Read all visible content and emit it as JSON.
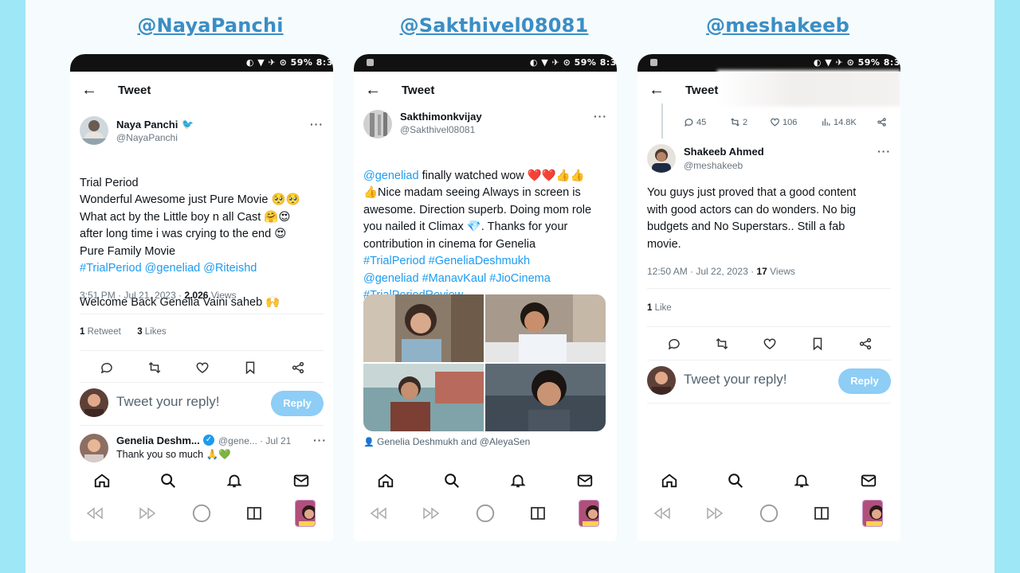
{
  "colors": {
    "page_bg": "#9ee7f7",
    "board_bg": "#f6fbfd",
    "handle": "#3a8ec5",
    "link": "#1d9bf0",
    "reply_btn": "#8dcdf6"
  },
  "status": {
    "icons": "◐ ▼ ✈ ⊙ 59% 8:3"
  },
  "common": {
    "tweet_title": "Tweet",
    "reply_placeholder": "Tweet your reply!",
    "reply_button": "Reply",
    "more": "···"
  },
  "panels": [
    {
      "handle_label": "@NayaPanchi",
      "author": {
        "name": "Naya Panchi",
        "handle": "@NayaPanchi",
        "verified": true
      },
      "text_plain": "Trial Period\nWonderful Awesome just Pure Movie 🥺🥺\nWhat act by the Little boy n all Cast 🤗😍\nafter long time i was crying to the end 😍\nPure Family Movie",
      "text_links": "#TrialPeriod @geneliad @Riteishd",
      "text_tail": "Welcome Back Genelia Vaini saheb 🙌",
      "meta_time": "3:51 PM · Jul 21, 2023 · ",
      "meta_views_count": "2,026",
      "meta_views_label": " Views",
      "retweets_count": "1",
      "retweets_label": " Retweet",
      "likes_count": "3",
      "likes_label": " Likes",
      "sub_reply": {
        "name": "Genelia Deshm...",
        "handle": "@gene...",
        "date": "· Jul 21",
        "text": "Thank you so much 🙏💚"
      }
    },
    {
      "handle_label": "@Sakthivel08081",
      "author": {
        "name": "Sakthimonkvijay",
        "handle": "@Sakthivel08081"
      },
      "text_mention": "@geneliad",
      "text_body": " finally watched wow ❤️❤️👍👍\n👍Nice madam seeing Always in screen is\nawesome. Direction superb. Doing mom role\nyou nailed it Climax 💎. Thanks for your\ncontribution in cinema for Genelia",
      "text_tags": "#TrialPeriod #GeneliaDeshmukh\n@geneliad #ManavKaul #JioCinema\n#TrialPeriodReview",
      "media_tag": "Genelia Deshmukh and @AleyaSen"
    },
    {
      "handle_label": "@meshakeeb",
      "parent_stats": {
        "replies": "45",
        "retweets": "2",
        "likes": "106",
        "views": "14.8K"
      },
      "author": {
        "name": "Shakeeb Ahmed",
        "handle": "@meshakeeb"
      },
      "text": "You guys just proved that a good content\nwith good actors can do wonders. No big\nbudgets and No Superstars.. Still a fab\nmovie.",
      "meta_time": "12:50 AM · Jul 22, 2023 · ",
      "meta_views_count": "17",
      "meta_views_label": " Views",
      "likes_count": "1",
      "likes_label": " Like"
    }
  ]
}
